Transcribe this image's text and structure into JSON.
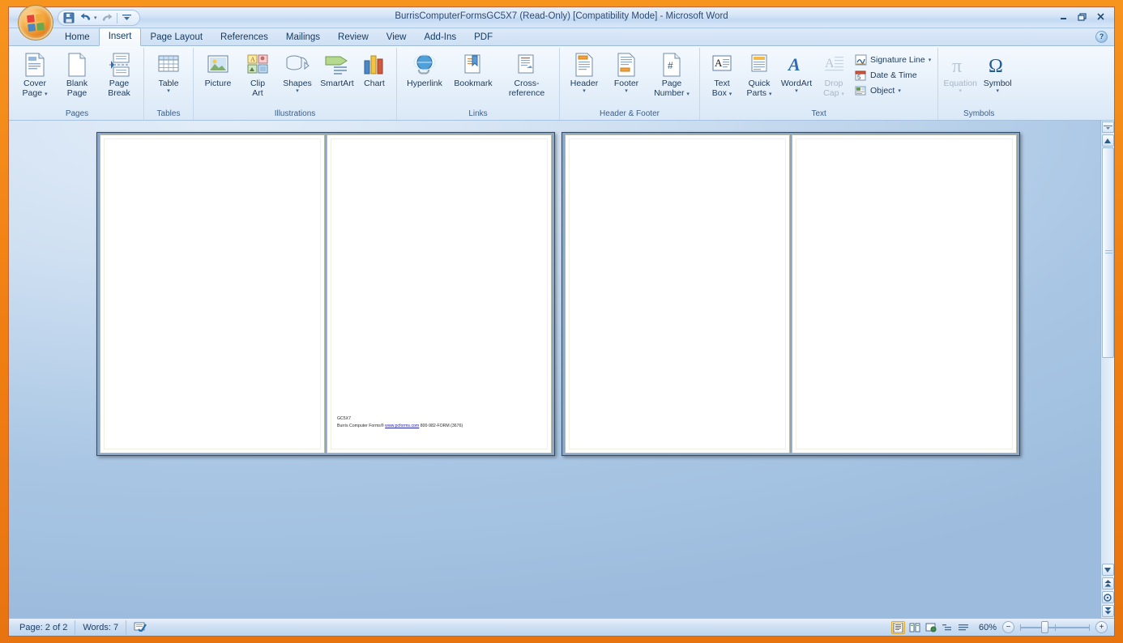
{
  "window": {
    "title": "BurrisComputerFormsGC5X7 (Read-Only) [Compatibility Mode] - Microsoft Word",
    "minimize": "Minimize",
    "restore": "Restore Down",
    "close": "Close"
  },
  "quick_access": {
    "office_button": "Office Button",
    "save": "Save",
    "undo": "Undo",
    "redo": "Repeat",
    "customize": "Customize Quick Access Toolbar"
  },
  "tabs": [
    {
      "label": "Home",
      "active": false
    },
    {
      "label": "Insert",
      "active": true
    },
    {
      "label": "Page Layout",
      "active": false
    },
    {
      "label": "References",
      "active": false
    },
    {
      "label": "Mailings",
      "active": false
    },
    {
      "label": "Review",
      "active": false
    },
    {
      "label": "View",
      "active": false
    },
    {
      "label": "Add-Ins",
      "active": false
    },
    {
      "label": "PDF",
      "active": false
    }
  ],
  "help": {
    "label": "?"
  },
  "ribbon": {
    "groups": [
      {
        "name": "Pages",
        "label": "Pages",
        "buttons": [
          {
            "label": "Cover\nPage",
            "line1": "Cover",
            "line2": "Page",
            "caret": true,
            "enabled": true
          },
          {
            "label": "Blank\nPage",
            "line1": "Blank",
            "line2": "Page",
            "caret": false,
            "enabled": true
          },
          {
            "label": "Page\nBreak",
            "line1": "Page",
            "line2": "Break",
            "caret": false,
            "enabled": true
          }
        ]
      },
      {
        "name": "Tables",
        "label": "Tables",
        "buttons": [
          {
            "line1": "Table",
            "line2": "",
            "caret": true,
            "enabled": true
          }
        ]
      },
      {
        "name": "Illustrations",
        "label": "Illustrations",
        "buttons": [
          {
            "line1": "Picture",
            "line2": "",
            "caret": false,
            "enabled": true
          },
          {
            "line1": "Clip",
            "line2": "Art",
            "caret": false,
            "enabled": true
          },
          {
            "line1": "Shapes",
            "line2": "",
            "caret": true,
            "enabled": true
          },
          {
            "line1": "SmartArt",
            "line2": "",
            "caret": false,
            "enabled": true
          },
          {
            "line1": "Chart",
            "line2": "",
            "caret": false,
            "enabled": true
          }
        ]
      },
      {
        "name": "Links",
        "label": "Links",
        "buttons": [
          {
            "line1": "Hyperlink",
            "line2": "",
            "caret": false,
            "enabled": true
          },
          {
            "line1": "Bookmark",
            "line2": "",
            "caret": false,
            "enabled": true
          },
          {
            "line1": "Cross-reference",
            "line2": "",
            "caret": false,
            "enabled": true
          }
        ]
      },
      {
        "name": "Header & Footer",
        "label": "Header & Footer",
        "buttons": [
          {
            "line1": "Header",
            "line2": "",
            "caret": true,
            "enabled": true
          },
          {
            "line1": "Footer",
            "line2": "",
            "caret": true,
            "enabled": true
          },
          {
            "line1": "Page",
            "line2": "Number",
            "caret": true,
            "enabled": true
          }
        ]
      },
      {
        "name": "Text",
        "label": "Text",
        "buttons": [
          {
            "line1": "Text",
            "line2": "Box",
            "caret": true,
            "enabled": true
          },
          {
            "line1": "Quick",
            "line2": "Parts",
            "caret": true,
            "enabled": true
          },
          {
            "line1": "WordArt",
            "line2": "",
            "caret": true,
            "enabled": true
          },
          {
            "line1": "Drop",
            "line2": "Cap",
            "caret": true,
            "enabled": false
          }
        ],
        "small_buttons": [
          {
            "label": "Signature Line",
            "caret": true,
            "enabled": true
          },
          {
            "label": "Date & Time",
            "caret": false,
            "enabled": true
          },
          {
            "label": "Object",
            "caret": true,
            "enabled": true
          }
        ]
      },
      {
        "name": "Symbols",
        "label": "Symbols",
        "buttons": [
          {
            "line1": "Equation",
            "line2": "",
            "caret": true,
            "enabled": false
          },
          {
            "line1": "Symbol",
            "line2": "",
            "caret": true,
            "enabled": true
          }
        ]
      }
    ]
  },
  "document": {
    "pages": [
      {
        "index": 1,
        "content": []
      },
      {
        "index": 2,
        "content": [
          {
            "text": "GC5X7",
            "link": null
          },
          {
            "text": "Burris Computer Forms® ",
            "link": "www.pcforms.com",
            "after": " 800-982-FORM (3676)"
          }
        ]
      },
      {
        "index": 3,
        "content": []
      },
      {
        "index": 4,
        "content": []
      }
    ],
    "footer_code": "GC5X7",
    "footer_company": "Burris Computer Forms® ",
    "footer_link": "www.pcforms.com",
    "footer_phone": " 800-982-FORM (3676)"
  },
  "status_bar": {
    "page": "Page: 2 of 2",
    "words": "Words: 7",
    "proofing": "proofing-errors",
    "zoom_level": "60%",
    "zoom_out": "−",
    "zoom_in": "+",
    "views": [
      {
        "name": "print-layout",
        "selected": true
      },
      {
        "name": "full-screen-reading",
        "selected": false
      },
      {
        "name": "web-layout",
        "selected": false
      },
      {
        "name": "outline",
        "selected": false
      },
      {
        "name": "draft",
        "selected": false
      }
    ]
  },
  "scrollbar": {
    "up": "▲",
    "down": "▼",
    "previous_page": "Previous Page",
    "select_browse_object": "Select Browse Object",
    "next_page": "Next Page"
  },
  "colors": {
    "frame": "#f7941e",
    "ribbon_bg": "#e6f0fa",
    "canvas_bg": "#a9c6e4",
    "accent_text": "#1d3f66"
  }
}
